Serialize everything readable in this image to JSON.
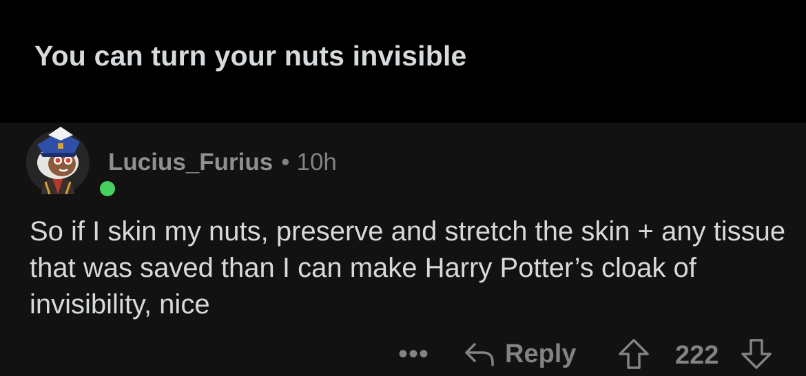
{
  "post": {
    "title": "You can turn your nuts invisible"
  },
  "comment": {
    "username": "Lucius_Furius",
    "separator": "•",
    "age": "10h",
    "body": "So if I skin my nuts, preserve and stretch the skin + any tissue that was saved than I can make Harry Potter’s cloak of invisibility, nice",
    "avatar_icon": "snoo-avatar-icon",
    "online_status": "online"
  },
  "actions": {
    "more_label": "•••",
    "reply_label": "Reply",
    "score": "222"
  },
  "colors": {
    "background": "#121212",
    "header_background": "#000000",
    "text": "#d7dadc",
    "muted": "#818384",
    "online": "#46d160"
  }
}
